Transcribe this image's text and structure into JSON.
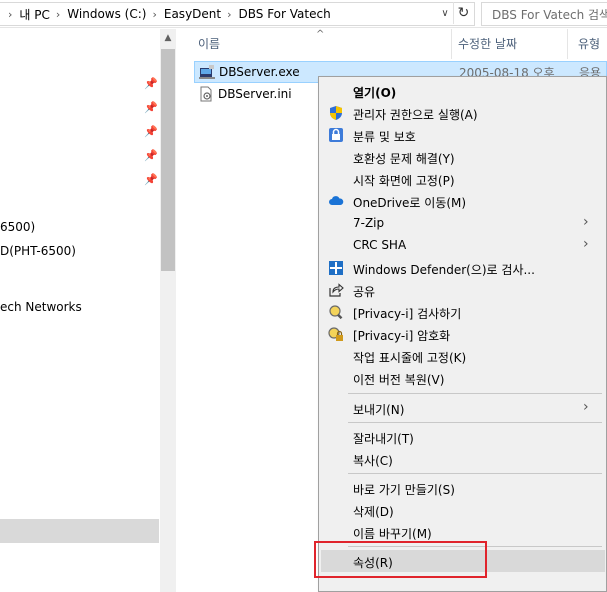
{
  "address_bar": {
    "breadcrumbs": [
      "내 PC",
      "Windows (C:)",
      "EasyDent",
      "DBS For Vatech"
    ],
    "search_placeholder": "DBS For Vatech 검색"
  },
  "nav_pane": {
    "items": [
      {
        "label": "6500)"
      },
      {
        "label": "D(PHT-6500)"
      },
      {
        "label": "ech Networks"
      }
    ]
  },
  "file_list": {
    "columns": {
      "name": "이름",
      "date": "수정한 날짜",
      "type": "유형"
    },
    "files": [
      {
        "name": "DBServer.exe",
        "date": "2005-08-18 오후",
        "type": "응용"
      },
      {
        "name": "DBServer.ini",
        "date": "",
        "type": ""
      }
    ]
  },
  "context_menu": {
    "items": [
      {
        "label": "열기(O)",
        "icon": "none"
      },
      {
        "label": "관리자 권한으로 실행(A)",
        "icon": "uac-shield-icon"
      },
      {
        "label": "분류 및 보호",
        "icon": "lock-icon"
      },
      {
        "label": "호환성 문제 해결(Y)",
        "icon": "none"
      },
      {
        "label": "시작 화면에 고정(P)",
        "icon": "none"
      },
      {
        "label": "OneDrive로 이동(M)",
        "icon": "cloud-icon"
      },
      {
        "label": "7-Zip",
        "icon": "none"
      },
      {
        "label": "CRC SHA",
        "icon": "none"
      },
      {
        "label": "Windows Defender(으)로 검사...",
        "icon": "defender-icon"
      },
      {
        "label": "공유",
        "icon": "share-icon"
      },
      {
        "label": "[Privacy-i] 검사하기",
        "icon": "privacy-scan-icon"
      },
      {
        "label": "[Privacy-i] 암호화",
        "icon": "privacy-lock-icon"
      },
      {
        "label": "작업 표시줄에 고정(K)",
        "icon": "none"
      },
      {
        "label": "이전 버전 복원(V)",
        "icon": "none"
      },
      {
        "label": "보내기(N)",
        "icon": "none"
      },
      {
        "label": "잘라내기(T)",
        "icon": "none"
      },
      {
        "label": "복사(C)",
        "icon": "none"
      },
      {
        "label": "바로 가기 만들기(S)",
        "icon": "none"
      },
      {
        "label": "삭제(D)",
        "icon": "none"
      },
      {
        "label": "이름 바꾸기(M)",
        "icon": "none"
      },
      {
        "label": "속성(R)",
        "icon": "none"
      }
    ]
  },
  "colors": {
    "selection": "#cce8ff",
    "menu_bg": "#f0f0f0",
    "hover": "#d9d9d9",
    "highlight": "#e0242c"
  }
}
